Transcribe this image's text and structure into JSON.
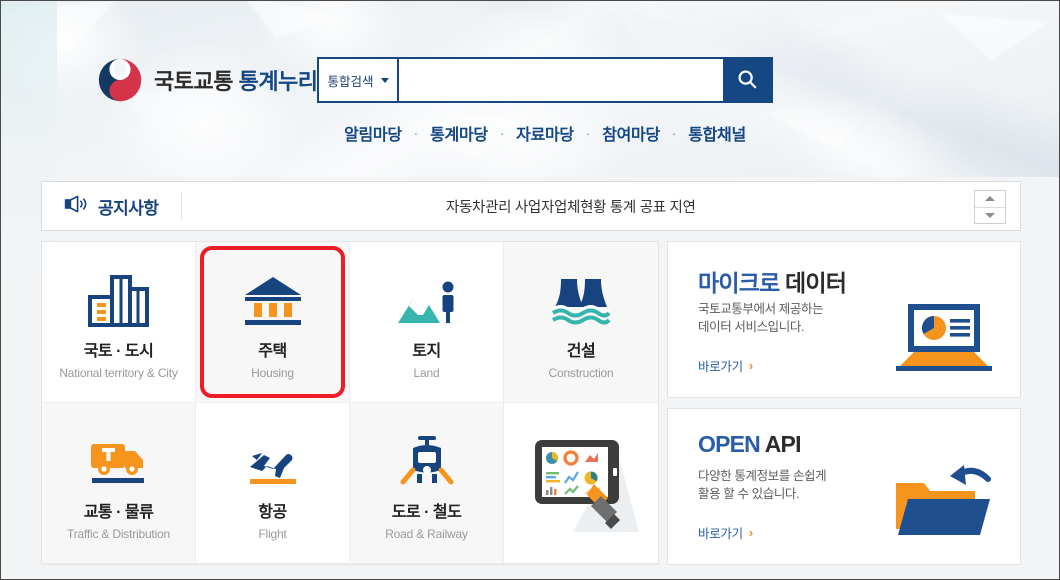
{
  "header": {
    "logo_icon": "taegeuk-logo",
    "brand_prefix": "국토교통 ",
    "brand_accent": "통계누리",
    "search": {
      "category_label": "통합검색",
      "caret_icon": "chevron-down-icon",
      "input_value": "",
      "input_placeholder": "",
      "button_icon": "search-icon"
    },
    "nav": [
      {
        "label": "알림마당"
      },
      {
        "label": "통계마당"
      },
      {
        "label": "자료마당"
      },
      {
        "label": "참여마당"
      },
      {
        "label": "통합채널"
      }
    ],
    "nav_separator": "·"
  },
  "notice": {
    "icon": "megaphone-icon",
    "label": "공지사항",
    "text": "자동차관리 사업자업체현황 통계 공표 지연",
    "prev_icon": "chevron-up-icon",
    "next_icon": "chevron-down-icon"
  },
  "tiles": [
    {
      "ko": "국토 · 도시",
      "en": "National territory & City",
      "icon": "city-buildings-icon",
      "selected": false
    },
    {
      "ko": "주택",
      "en": "Housing",
      "icon": "bank-building-icon",
      "selected": true
    },
    {
      "ko": "토지",
      "en": "Land",
      "icon": "mountain-person-icon",
      "selected": false
    },
    {
      "ko": "건설",
      "en": "Construction",
      "icon": "dam-water-icon",
      "selected": false
    },
    {
      "ko": "교통 · 물류",
      "en": "Traffic & Distribution",
      "icon": "truck-icon",
      "selected": false
    },
    {
      "ko": "항공",
      "en": "Flight",
      "icon": "airplane-takeoff-icon",
      "selected": false
    },
    {
      "ko": "도로 · 철도",
      "en": "Road & Railway",
      "icon": "train-icon",
      "selected": false
    },
    {
      "ko": "",
      "en": "",
      "icon": "tablet-charts-hand-illustration",
      "selected": false
    }
  ],
  "promos": [
    {
      "title_accent": "마이크로",
      "title_rest": " 데이터",
      "desc_line1": "국토교통부에서 제공하는",
      "desc_line2": "데이터 서비스입니다.",
      "link_label": "바로가기",
      "link_arrow": "›",
      "art_icon": "laptop-piechart-icon"
    },
    {
      "title_accent": "OPEN",
      "title_rest": " API",
      "desc_line1": "다양한 통계정보를 손쉽게",
      "desc_line2": "활용 할 수 있습니다.",
      "link_label": "바로가기",
      "link_arrow": "›",
      "art_icon": "open-folder-arrow-icon"
    }
  ],
  "colors": {
    "brand_navy": "#154785",
    "accent_blue": "#2a5ca8",
    "accent_orange": "#f28d2b",
    "highlight_red": "#ee1c25",
    "teal": "#35b5ae"
  }
}
